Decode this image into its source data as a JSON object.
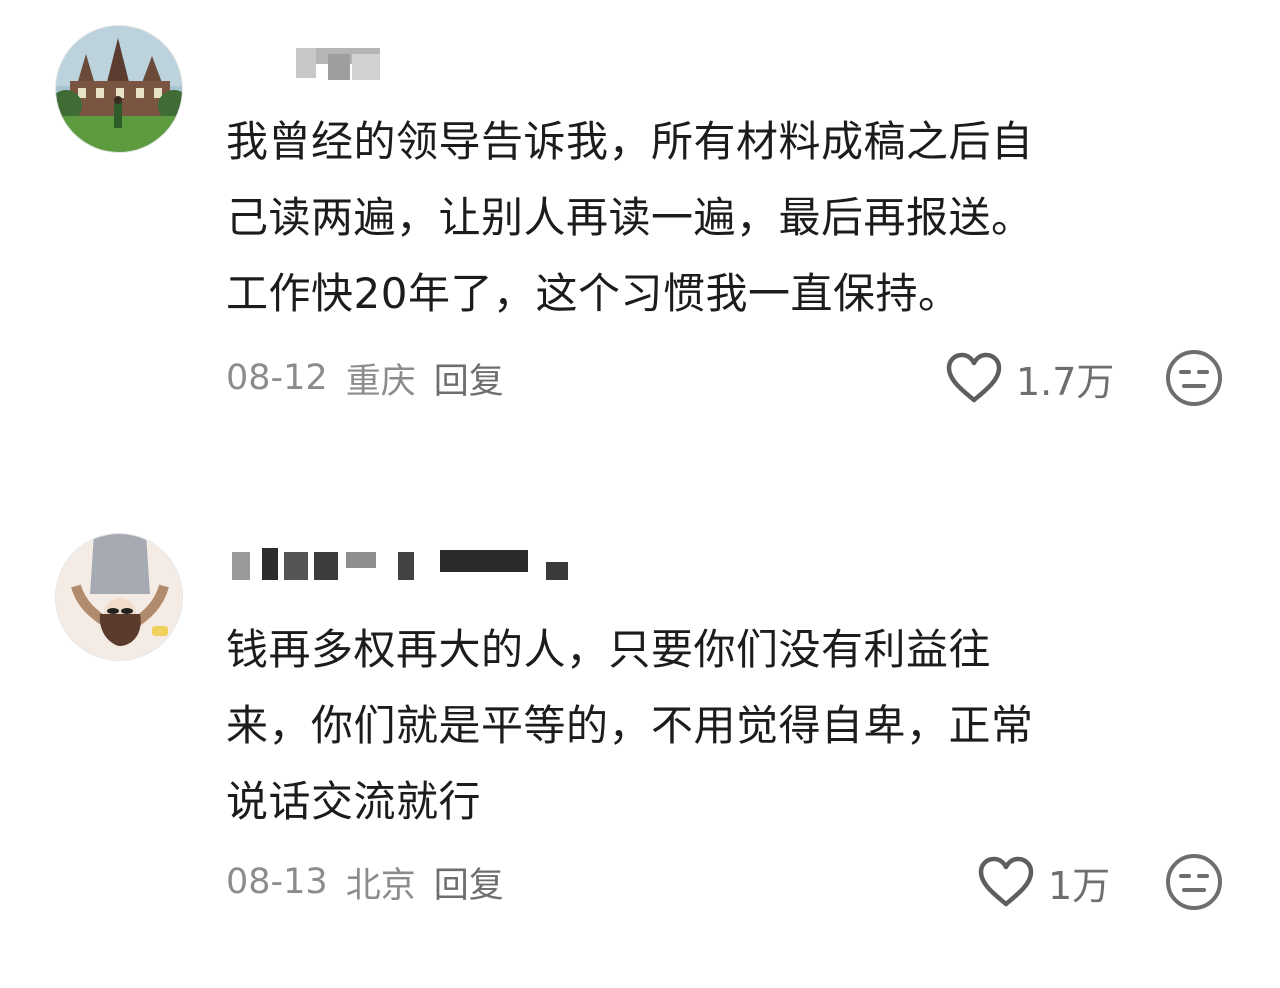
{
  "comments": [
    {
      "text": "我曾经的领导告诉我，所有材料成稿之后自\n己读两遍，让别人再读一遍，最后再报送。\n工作快20年了，这个习惯我一直保持。",
      "date": "08-12",
      "location": "重庆",
      "reply_label": "回复",
      "like_count": "1.7万",
      "like_icon": "heart-outline-icon",
      "dislike_icon": "neutral-face-icon"
    },
    {
      "text": "钱再多权再大的人，只要你们没有利益往\n来，你们就是平等的，不用觉得自卑，正常\n说话交流就行",
      "date": "08-13",
      "location": "北京",
      "reply_label": "回复",
      "like_count": "1万",
      "like_icon": "heart-outline-icon",
      "dislike_icon": "neutral-face-icon"
    }
  ],
  "colors": {
    "text": "#1c1c1c",
    "meta": "#8c8c8c",
    "icon": "#6e6e6e",
    "background": "#ffffff"
  }
}
